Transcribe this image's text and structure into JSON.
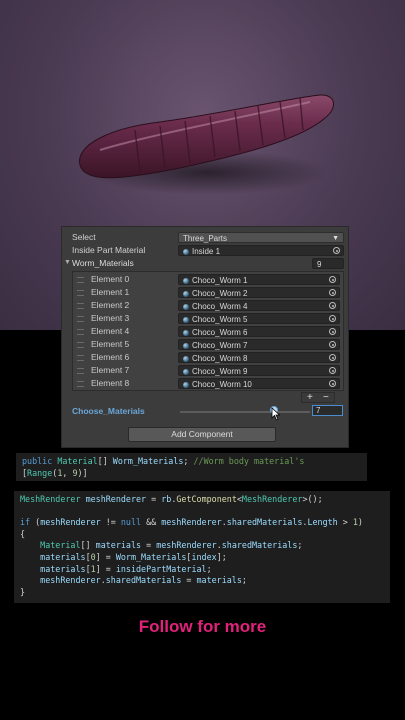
{
  "inspector": {
    "select": {
      "label": "Select",
      "value": "Three_Parts"
    },
    "inside_part": {
      "label": "Inside Part Material",
      "value": "Inside 1"
    },
    "worm_materials": {
      "label": "Worm_Materials",
      "count": "9"
    },
    "elements": [
      {
        "label": "Element 0",
        "value": "Choco_Worm 1"
      },
      {
        "label": "Element 1",
        "value": "Choco_Worm 2"
      },
      {
        "label": "Element 2",
        "value": "Choco_Worm 4"
      },
      {
        "label": "Element 3",
        "value": "Choco_Worm 5"
      },
      {
        "label": "Element 4",
        "value": "Choco_Worm 6"
      },
      {
        "label": "Element 5",
        "value": "Choco_Worm 7"
      },
      {
        "label": "Element 6",
        "value": "Choco_Worm 8"
      },
      {
        "label": "Element 7",
        "value": "Choco_Worm 9"
      },
      {
        "label": "Element 8",
        "value": "Choco_Worm 10"
      }
    ],
    "plus": "+",
    "minus": "−",
    "choose_materials": {
      "label": "Choose_Materials",
      "value": "7",
      "slider_fraction": 0.75,
      "accent": "#4b8ed0"
    },
    "add_component": "Add Component"
  },
  "code_snippets": {
    "line1": "public Material[] Worm_Materials; //Worm body material's",
    "line2": "[Range(1, 9)]",
    "block": [
      "MeshRenderer meshRenderer = rb.GetComponent<MeshRenderer>();",
      "",
      "if (meshRenderer != null && meshRenderer.sharedMaterials.Length > 1)",
      "{",
      "    Material[] materials = meshRenderer.sharedMaterials;",
      "    materials[0] = Worm_Materials[index];",
      "    materials[1] = insidePartMaterial;",
      "    meshRenderer.sharedMaterials = materials;",
      "}"
    ]
  },
  "footer": {
    "text": "Follow for more",
    "color": "#e0227a"
  },
  "colors": {
    "worm": "#5a1f3c",
    "scene": "#4a3a52",
    "panel": "#3c3c3c"
  }
}
